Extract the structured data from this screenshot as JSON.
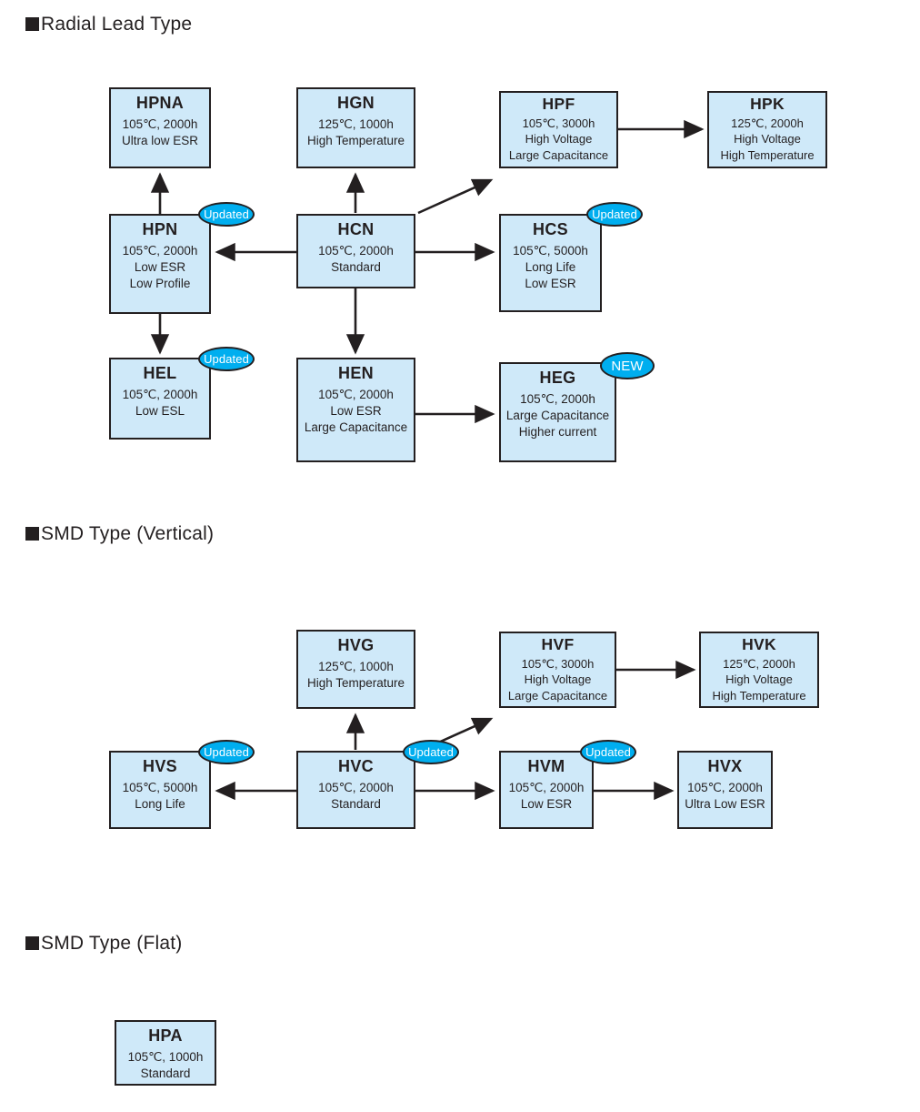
{
  "sections": [
    {
      "id": "radial",
      "label": "Radial Lead Type"
    },
    {
      "id": "smd_vertical",
      "label": "SMD Type (Vertical)"
    },
    {
      "id": "smd_flat",
      "label": "SMD Type (Flat)"
    }
  ],
  "badges": {
    "updated_label": "Updated",
    "new_label": "NEW",
    "color": "#00aeef"
  },
  "colors": {
    "box_fill": "#cfe9f9",
    "box_border": "#231f20",
    "text": "#231f20",
    "badge_fill": "#00aeef",
    "badge_text": "#ffffff"
  },
  "nodes": {
    "hpna": {
      "title": "HPNA",
      "l1": "105℃, 2000h",
      "l2": "Ultra low ESR",
      "l3": "",
      "l4": ""
    },
    "hpn": {
      "title": "HPN",
      "l1": "105℃, 2000h",
      "l2": "Low ESR",
      "l3": "Low Profile",
      "l4": ""
    },
    "hel": {
      "title": "HEL",
      "l1": "105℃, 2000h",
      "l2": "Low ESL",
      "l3": "",
      "l4": ""
    },
    "hgn": {
      "title": "HGN",
      "l1": "125℃, 1000h",
      "l2": "High Temperature",
      "l3": "",
      "l4": ""
    },
    "hcn": {
      "title": "HCN",
      "l1": "105℃, 2000h",
      "l2": "Standard",
      "l3": "",
      "l4": ""
    },
    "hen": {
      "title": "HEN",
      "l1": "105℃, 2000h",
      "l2": "Low ESR",
      "l3": "Large Capacitance",
      "l4": ""
    },
    "hpf": {
      "title": "HPF",
      "l1": "105℃, 3000h",
      "l2": "High Voltage",
      "l3": "Large Capacitance",
      "l4": ""
    },
    "hcs": {
      "title": "HCS",
      "l1": "105℃, 5000h",
      "l2": "Long Life",
      "l3": "Low ESR",
      "l4": ""
    },
    "heg": {
      "title": "HEG",
      "l1": "105℃, 2000h",
      "l2": "Large Capacitance",
      "l3": "Higher current",
      "l4": ""
    },
    "hpk": {
      "title": "HPK",
      "l1": "125℃, 2000h",
      "l2": "High Voltage",
      "l3": "High Temperature",
      "l4": ""
    },
    "hvg": {
      "title": "HVG",
      "l1": "125℃, 1000h",
      "l2": "High Temperature",
      "l3": "",
      "l4": ""
    },
    "hvf": {
      "title": "HVF",
      "l1": "105℃, 3000h",
      "l2": "High Voltage",
      "l3": "Large Capacitance",
      "l4": ""
    },
    "hvk": {
      "title": "HVK",
      "l1": "125℃, 2000h",
      "l2": "High Voltage",
      "l3": "High Temperature",
      "l4": ""
    },
    "hvs": {
      "title": "HVS",
      "l1": "105℃, 5000h",
      "l2": "Long Life",
      "l3": "",
      "l4": ""
    },
    "hvc": {
      "title": "HVC",
      "l1": "105℃, 2000h",
      "l2": "Standard",
      "l3": "",
      "l4": ""
    },
    "hvm": {
      "title": "HVM",
      "l1": "105℃, 2000h",
      "l2": "Low ESR",
      "l3": "",
      "l4": ""
    },
    "hvx": {
      "title": "HVX",
      "l1": "105℃, 2000h",
      "l2": "Ultra Low ESR",
      "l3": "",
      "l4": ""
    },
    "hpa": {
      "title": "HPA",
      "l1": "105℃, 1000h",
      "l2": "Standard",
      "l3": "",
      "l4": ""
    }
  },
  "edges": [
    {
      "from": "hcn",
      "to": "hpna",
      "via": "hpn",
      "kind": "vertical-up"
    },
    {
      "from": "hpn",
      "to": "hpna",
      "kind": "vertical-up"
    },
    {
      "from": "hcn",
      "to": "hgn",
      "kind": "vertical-up"
    },
    {
      "from": "hcn",
      "to": "hpn",
      "kind": "horizontal-left"
    },
    {
      "from": "hcn",
      "to": "hcs",
      "kind": "horizontal-right"
    },
    {
      "from": "hcn",
      "to": "hpf",
      "kind": "diagonal-up-right"
    },
    {
      "from": "hcn",
      "to": "hen",
      "kind": "vertical-down"
    },
    {
      "from": "hpn",
      "to": "hel",
      "kind": "vertical-down"
    },
    {
      "from": "hen",
      "to": "heg",
      "kind": "horizontal-right"
    },
    {
      "from": "hpf",
      "to": "hpk",
      "kind": "horizontal-right"
    },
    {
      "from": "hvc",
      "to": "hvg",
      "kind": "vertical-up"
    },
    {
      "from": "hvc",
      "to": "hvf",
      "kind": "diagonal-up-right"
    },
    {
      "from": "hvc",
      "to": "hvs",
      "kind": "horizontal-left"
    },
    {
      "from": "hvc",
      "to": "hvm",
      "kind": "horizontal-right"
    },
    {
      "from": "hvm",
      "to": "hvx",
      "kind": "horizontal-right"
    },
    {
      "from": "hvf",
      "to": "hvk",
      "kind": "horizontal-right"
    }
  ],
  "node_badges": [
    {
      "node": "hpn",
      "type": "updated"
    },
    {
      "node": "hel",
      "type": "updated"
    },
    {
      "node": "hcs",
      "type": "updated"
    },
    {
      "node": "heg",
      "type": "new"
    },
    {
      "node": "hvs",
      "type": "updated"
    },
    {
      "node": "hvc",
      "type": "updated"
    },
    {
      "node": "hvm",
      "type": "updated"
    }
  ]
}
